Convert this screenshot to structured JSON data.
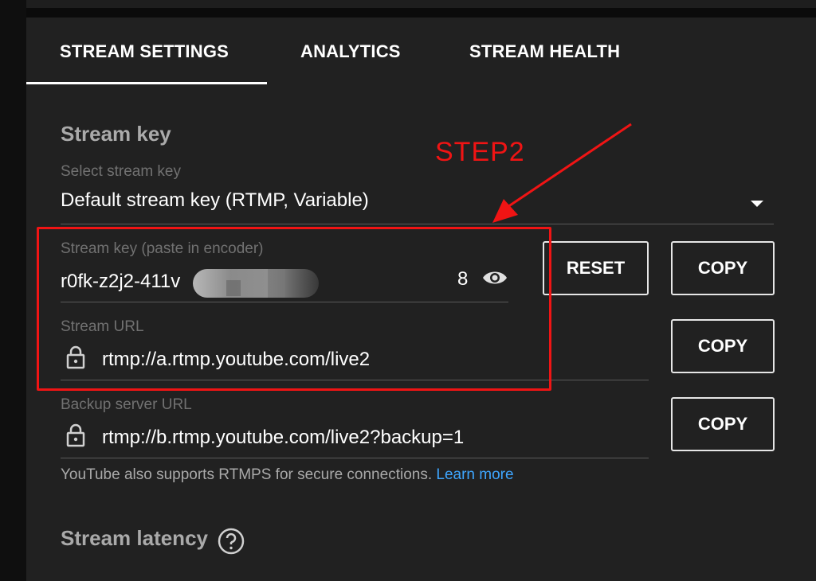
{
  "tabs": [
    {
      "label": "STREAM SETTINGS",
      "active": true
    },
    {
      "label": "ANALYTICS",
      "active": false
    },
    {
      "label": "STREAM HEALTH",
      "active": false
    }
  ],
  "stream_key_section": {
    "title": "Stream key",
    "select_label": "Select stream key",
    "select_value": "Default stream key (RTMP, Variable)",
    "key_field_label": "Stream key (paste in encoder)",
    "key_field_value": "r0fk-z2j2-411v",
    "key_field_suffix": "8",
    "reset_label": "RESET",
    "copy_key_label": "COPY",
    "url_label": "Stream URL",
    "url_value": "rtmp://a.rtmp.youtube.com/live2",
    "copy_url_label": "COPY",
    "backup_label": "Backup server URL",
    "backup_value": "rtmp://b.rtmp.youtube.com/live2?backup=1",
    "copy_backup_label": "COPY",
    "helper_text": "YouTube also supports RTMPS for secure connections.",
    "helper_link": "Learn more"
  },
  "latency_section": {
    "title": "Stream latency"
  },
  "annotation": {
    "step_label": "STEP2",
    "color": "#f01414"
  },
  "icons": {
    "dropdown": "caret-down-icon",
    "visibility": "eye-icon",
    "lock": "lock-icon",
    "help": "question-circle-icon"
  },
  "colors": {
    "background": "#212121",
    "link": "#3ea6ff",
    "annotation_red": "#f01414"
  }
}
